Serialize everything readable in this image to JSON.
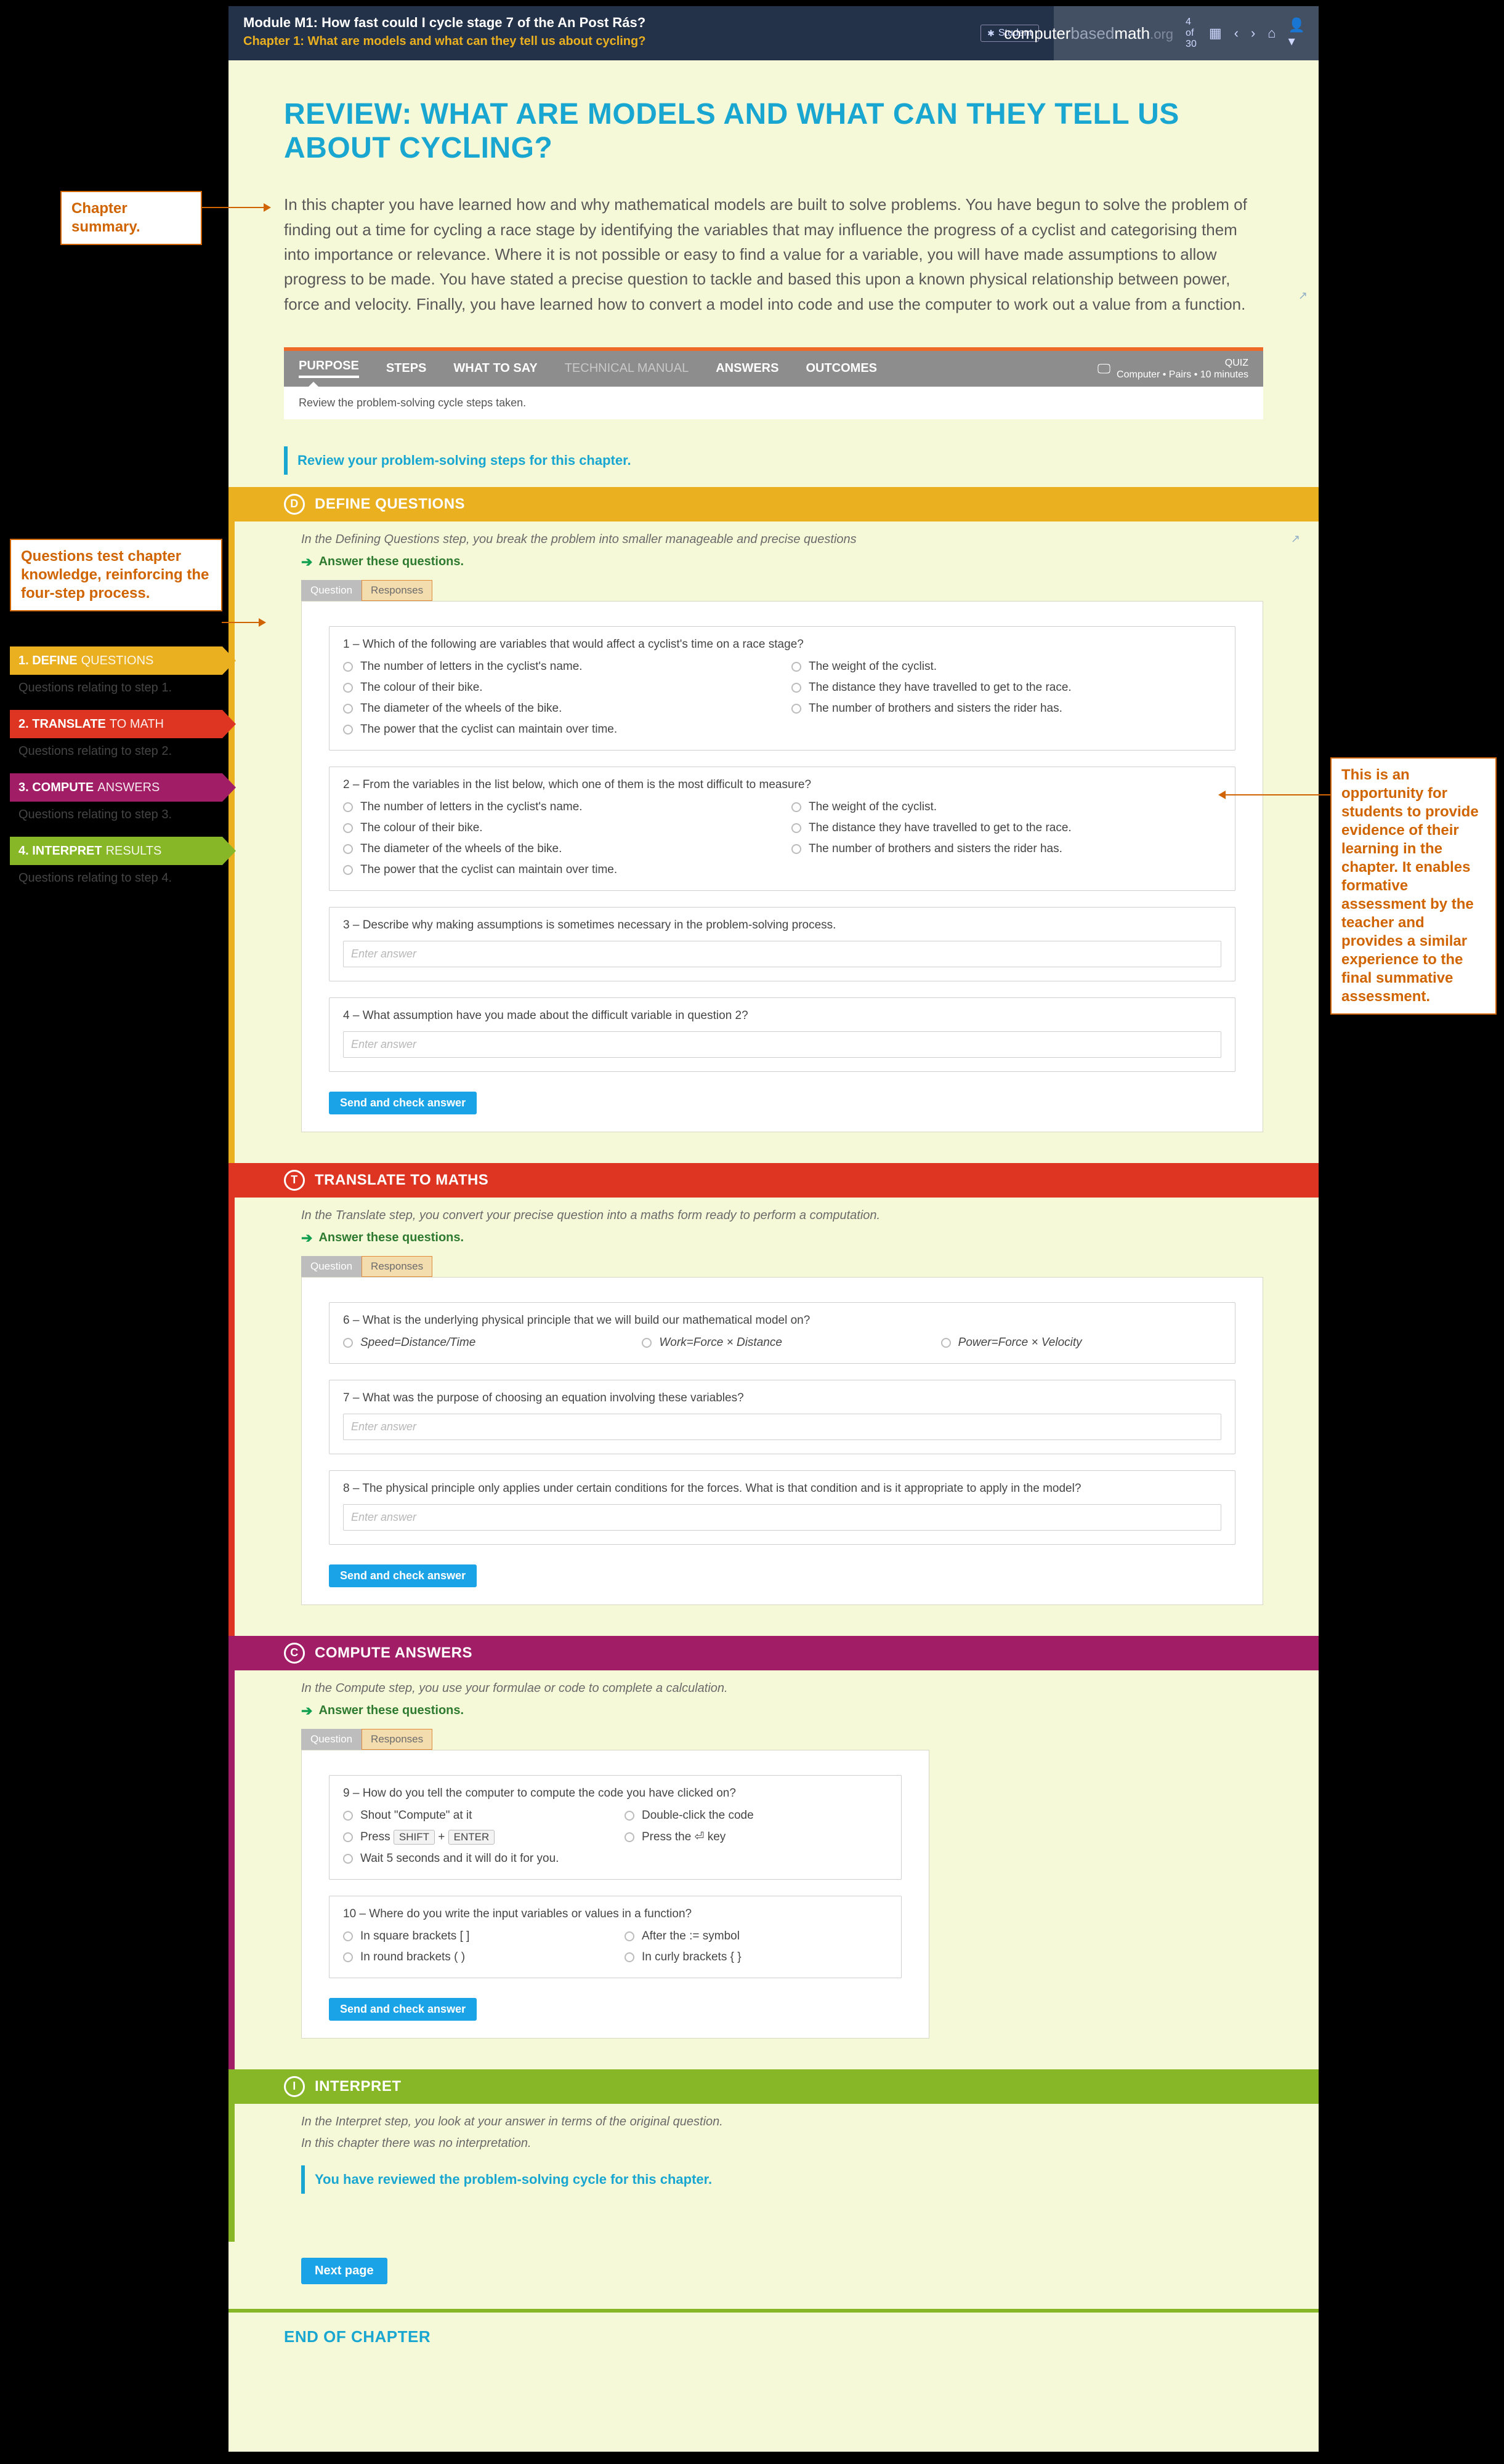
{
  "header": {
    "module": "Module M1: How fast could I cycle stage 7 of the An Post Rás?",
    "chapter": "Chapter 1: What are models and what can they tell us about cycling?",
    "student_badge": "Student",
    "brand_pre": "computer",
    "brand_mid": "based",
    "brand_post": "math",
    "brand_tld": ".org",
    "nav_pos": "4 of 30"
  },
  "title": "REVIEW: WHAT ARE MODELS AND WHAT CAN THEY TELL US ABOUT CYCLING?",
  "summary": "In this chapter you have learned how and why mathematical models are built to solve problems. You have begun to solve the problem of finding out a time for cycling a race stage by identifying the variables that may influence the progress of a cyclist and categorising them into importance or relevance. Where it is not possible or easy to find a value for a variable, you will have made assumptions to allow progress to be made. You have stated a precise question to tackle and based this upon a known physical relationship between power, force and velocity. Finally, you have learned how to convert a model into code and use the computer to work out a value from a function.",
  "tabs": {
    "items": [
      "PURPOSE",
      "STEPS",
      "WHAT TO SAY",
      "TECHNICAL MANUAL",
      "ANSWERS",
      "OUTCOMES"
    ],
    "quiz_label": "QUIZ",
    "quiz_sub": "Computer • Pairs • 10 minutes",
    "note": "Review the problem-solving cycle steps taken."
  },
  "review_line": "Review your problem-solving steps for this chapter.",
  "qr": {
    "question": "Question",
    "responses": "Responses"
  },
  "answer_these": "Answer these questions.",
  "enter_answer": "Enter answer",
  "send_btn": "Send and check answer",
  "define": {
    "label": "DEFINE QUESTIONS",
    "intro": "In the Defining Questions step, you break the problem into smaller manageable and precise questions",
    "q1": {
      "title": "1  –  Which of the following are variables that would affect a cyclist's time on a race stage?",
      "opts": [
        "The number of letters in the cyclist's name.",
        "The weight of the cyclist.",
        "The colour of their bike.",
        "The distance they have travelled to get to the race.",
        "The diameter of the wheels of the bike.",
        "The number of brothers and sisters the rider has.",
        "The power that the cyclist can maintain over time."
      ]
    },
    "q2": {
      "title": "2  –  From the variables in the list below, which one of them is the most difficult to measure?",
      "opts": [
        "The number of letters in the cyclist's name.",
        "The weight of the cyclist.",
        "The colour of their bike.",
        "The distance they have travelled to get to the race.",
        "The diameter of the wheels of the bike.",
        "The number of brothers and sisters the rider has.",
        "The power that the cyclist can maintain over time."
      ]
    },
    "q3": "3  –  Describe why making assumptions is sometimes necessary in the problem-solving process.",
    "q4": "4  –  What assumption have you made about the difficult variable in question 2?"
  },
  "translate": {
    "label": "TRANSLATE TO MATHS",
    "intro": "In the Translate step, you convert your precise question into a maths form ready to perform a computation.",
    "q6": {
      "title": "6  –  What is the underlying physical principle that we will build our mathematical model on?",
      "opts": [
        "Speed=Distance/Time",
        "Work=Force × Distance",
        "Power=Force × Velocity"
      ]
    },
    "q7": "7  –  What was the purpose of choosing an equation involving these variables?",
    "q8": "8  –  The physical principle only applies under certain conditions for the forces. What is that condition and is it appropriate to apply in the model?"
  },
  "compute": {
    "label": "COMPUTE ANSWERS",
    "intro": "In the Compute step, you use your formulae or code to complete a calculation.",
    "q9": {
      "title": "9  –  How do you tell the computer to compute the code you have clicked on?",
      "opt_a": "Shout \"Compute\" at it",
      "opt_b": "Double-click the code",
      "opt_c_pre": "Press ",
      "opt_c_k1": "SHIFT",
      "opt_c_plus": " + ",
      "opt_c_k2": "ENTER",
      "opt_d": "Press the ⏎ key",
      "opt_e": "Wait 5 seconds and it will do it for you."
    },
    "q10": {
      "title": "10 –  Where do you write the input variables or values in a function?",
      "opts": [
        "In square brackets [ ]",
        "After the := symbol",
        "In round brackets ( )",
        "In curly brackets { }"
      ]
    }
  },
  "interpret": {
    "label": "INTERPRET",
    "intro": "In the Interpret step, you look at your answer in terms of the original question.",
    "intro2": "In this chapter there was no interpretation.",
    "reviewed": "You have reviewed the problem-solving cycle for this chapter."
  },
  "next_page": "Next page",
  "end_chapter": "END OF CHAPTER",
  "annotations": {
    "chapter_summary": "Chapter summary.",
    "left_block": "Questions test chapter knowledge, reinforcing the four-step process.",
    "chips": [
      {
        "bold": "1. DEFINE",
        "light": "QUESTIONS",
        "sub": "Questions relating to step 1."
      },
      {
        "bold": "2. TRANSLATE",
        "light": "TO MATH",
        "sub": "Questions relating to step 2."
      },
      {
        "bold": "3. COMPUTE",
        "light": "ANSWERS",
        "sub": "Questions relating to step 3."
      },
      {
        "bold": "4. INTERPRET",
        "light": "RESULTS",
        "sub": "Questions relating to step 4."
      }
    ],
    "right_block": "This is an opportunity for students to provide evidence of their learning in the chapter. It enables formative assessment by the teacher and provides a similar experience to the final summative assessment."
  }
}
